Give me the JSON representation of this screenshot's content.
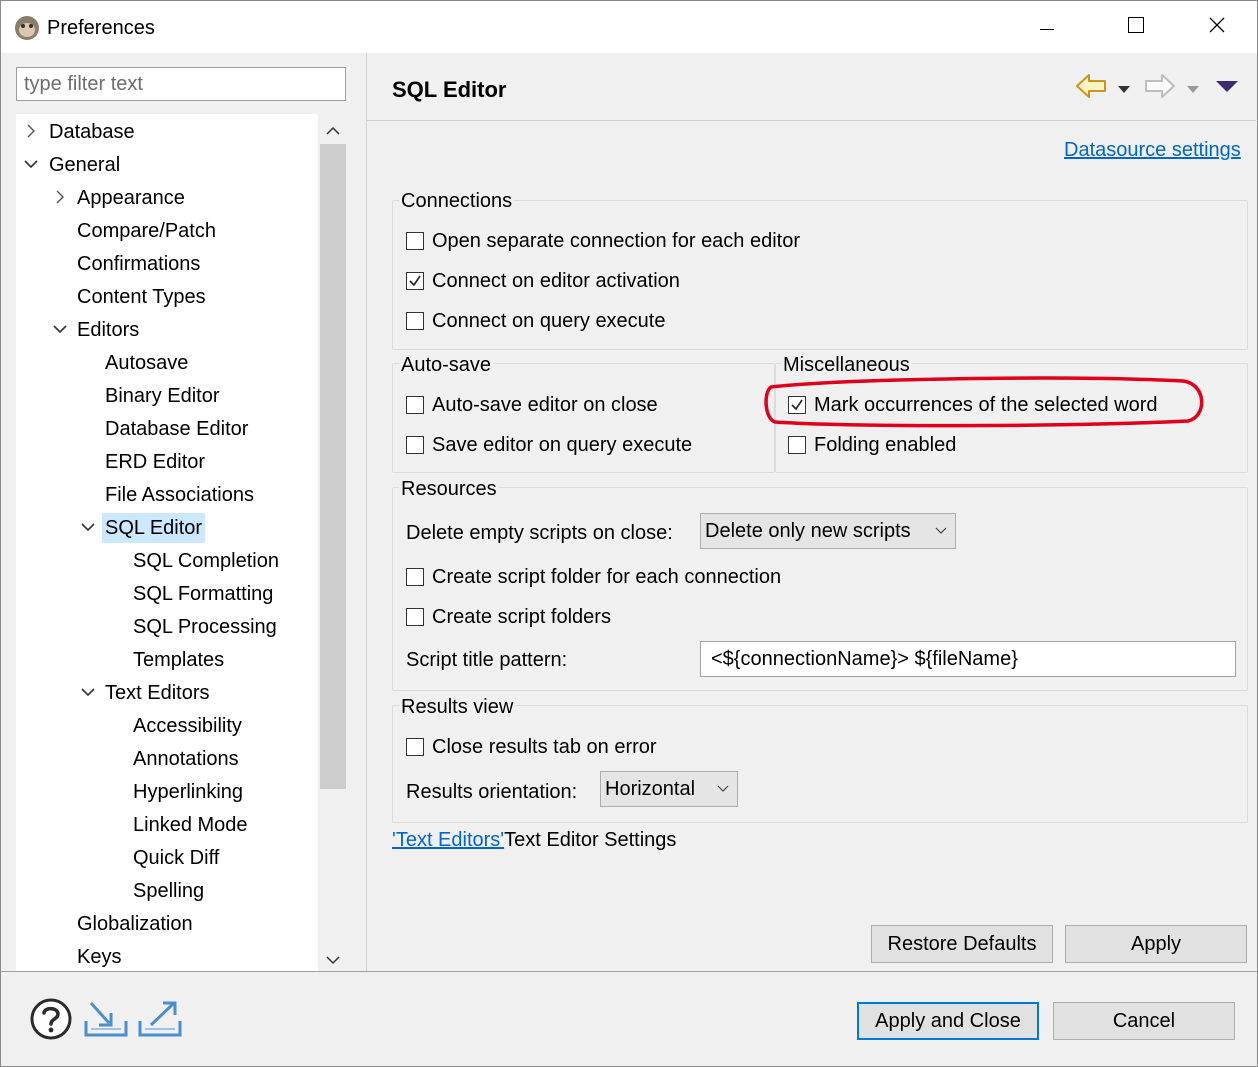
{
  "window": {
    "title": "Preferences"
  },
  "filter": {
    "placeholder": "type filter text"
  },
  "tree": {
    "items": [
      {
        "label": "Database"
      },
      {
        "label": "General"
      },
      {
        "label": "Appearance"
      },
      {
        "label": "Compare/Patch"
      },
      {
        "label": "Confirmations"
      },
      {
        "label": "Content Types"
      },
      {
        "label": "Editors"
      },
      {
        "label": "Autosave"
      },
      {
        "label": "Binary Editor"
      },
      {
        "label": "Database Editor"
      },
      {
        "label": "ERD Editor"
      },
      {
        "label": "File Associations"
      },
      {
        "label": "SQL Editor"
      },
      {
        "label": "SQL Completion"
      },
      {
        "label": "SQL Formatting"
      },
      {
        "label": "SQL Processing"
      },
      {
        "label": "Templates"
      },
      {
        "label": "Text Editors"
      },
      {
        "label": "Accessibility"
      },
      {
        "label": "Annotations"
      },
      {
        "label": "Hyperlinking"
      },
      {
        "label": "Linked Mode"
      },
      {
        "label": "Quick Diff"
      },
      {
        "label": "Spelling"
      },
      {
        "label": "Globalization"
      },
      {
        "label": "Keys"
      }
    ],
    "selected": "SQL Editor"
  },
  "page": {
    "title": "SQL Editor",
    "datasource_link": "Datasource settings",
    "connections": {
      "label": "Connections",
      "options": [
        {
          "label": "Open separate connection for each editor",
          "checked": false
        },
        {
          "label": "Connect on editor activation",
          "checked": true
        },
        {
          "label": "Connect on query execute",
          "checked": false
        }
      ]
    },
    "autosave": {
      "label": "Auto-save",
      "options": [
        {
          "label": "Auto-save editor on close",
          "checked": false
        },
        {
          "label": "Save editor on query execute",
          "checked": false
        }
      ]
    },
    "misc": {
      "label": "Miscellaneous",
      "options": [
        {
          "label": "Mark occurrences of the selected word",
          "checked": true
        },
        {
          "label": "Folding enabled",
          "checked": false
        }
      ]
    },
    "resources": {
      "label": "Resources",
      "delete_label": "Delete empty scripts on close:",
      "delete_value": "Delete only new scripts",
      "options": [
        {
          "label": "Create script folder for each connection",
          "checked": false
        },
        {
          "label": "Create script folders",
          "checked": false
        }
      ],
      "title_pattern_label": "Script title pattern:",
      "title_pattern_value": "<${connectionName}> ${fileName}"
    },
    "results": {
      "label": "Results view",
      "close_tab": {
        "label": "Close results tab on error",
        "checked": false
      },
      "orientation_label": "Results orientation:",
      "orientation_value": "Horizontal"
    },
    "text_editors_link": "'Text Editors'",
    "text_editors_suffix": "Text Editor Settings",
    "restore_defaults": "Restore Defaults",
    "apply": "Apply"
  },
  "footer": {
    "apply_close": "Apply and Close",
    "cancel": "Cancel"
  },
  "colors": {
    "accent": "#0078d7",
    "link": "#0066cc",
    "highlight_annotation": "#e0001b",
    "selection": "#cce8ff"
  }
}
